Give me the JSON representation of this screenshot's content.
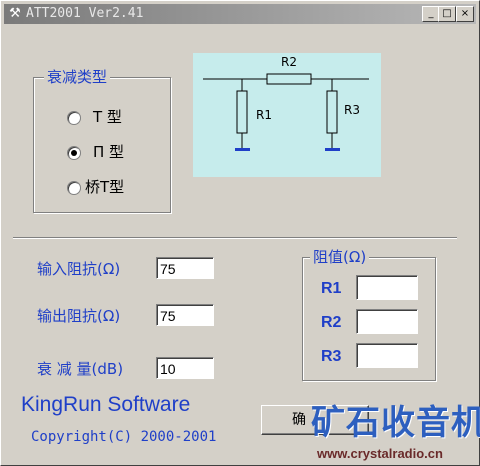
{
  "window": {
    "title": "ATT2001 Ver2.41",
    "icon": "tools-icon",
    "controls": {
      "minimize": "_",
      "maximize": "□",
      "close": "×"
    }
  },
  "type_group": {
    "title": "衰减类型",
    "options": [
      {
        "label": "T 型",
        "selected": false
      },
      {
        "label": "Π 型",
        "selected": true
      },
      {
        "label": "桥T型",
        "selected": false
      }
    ]
  },
  "diagram": {
    "background": "#c6ecec",
    "labels": {
      "r1": "R1",
      "r2": "R2",
      "r3": "R3"
    }
  },
  "fields": {
    "input_impedance": {
      "label": "输入阻抗(Ω)",
      "value": "75"
    },
    "output_impedance": {
      "label": "输出阻抗(Ω)",
      "value": "75"
    },
    "attenuation": {
      "label": "衰 减 量(dB)",
      "value": "10"
    }
  },
  "resistance_group": {
    "title": "阻值(Ω)",
    "rows": [
      {
        "name": "R1",
        "value": ""
      },
      {
        "name": "R2",
        "value": ""
      },
      {
        "name": "R3",
        "value": ""
      }
    ]
  },
  "footer": {
    "brand": "KingRun Software",
    "copyright": "Copyright(C) 2000-2001",
    "ok_button": "确"
  },
  "watermark": {
    "title": "矿石收音机",
    "url": "www.crystalradio.cn"
  },
  "colors": {
    "label_blue": "#1f3fc8",
    "face": "#d4d0c8"
  }
}
